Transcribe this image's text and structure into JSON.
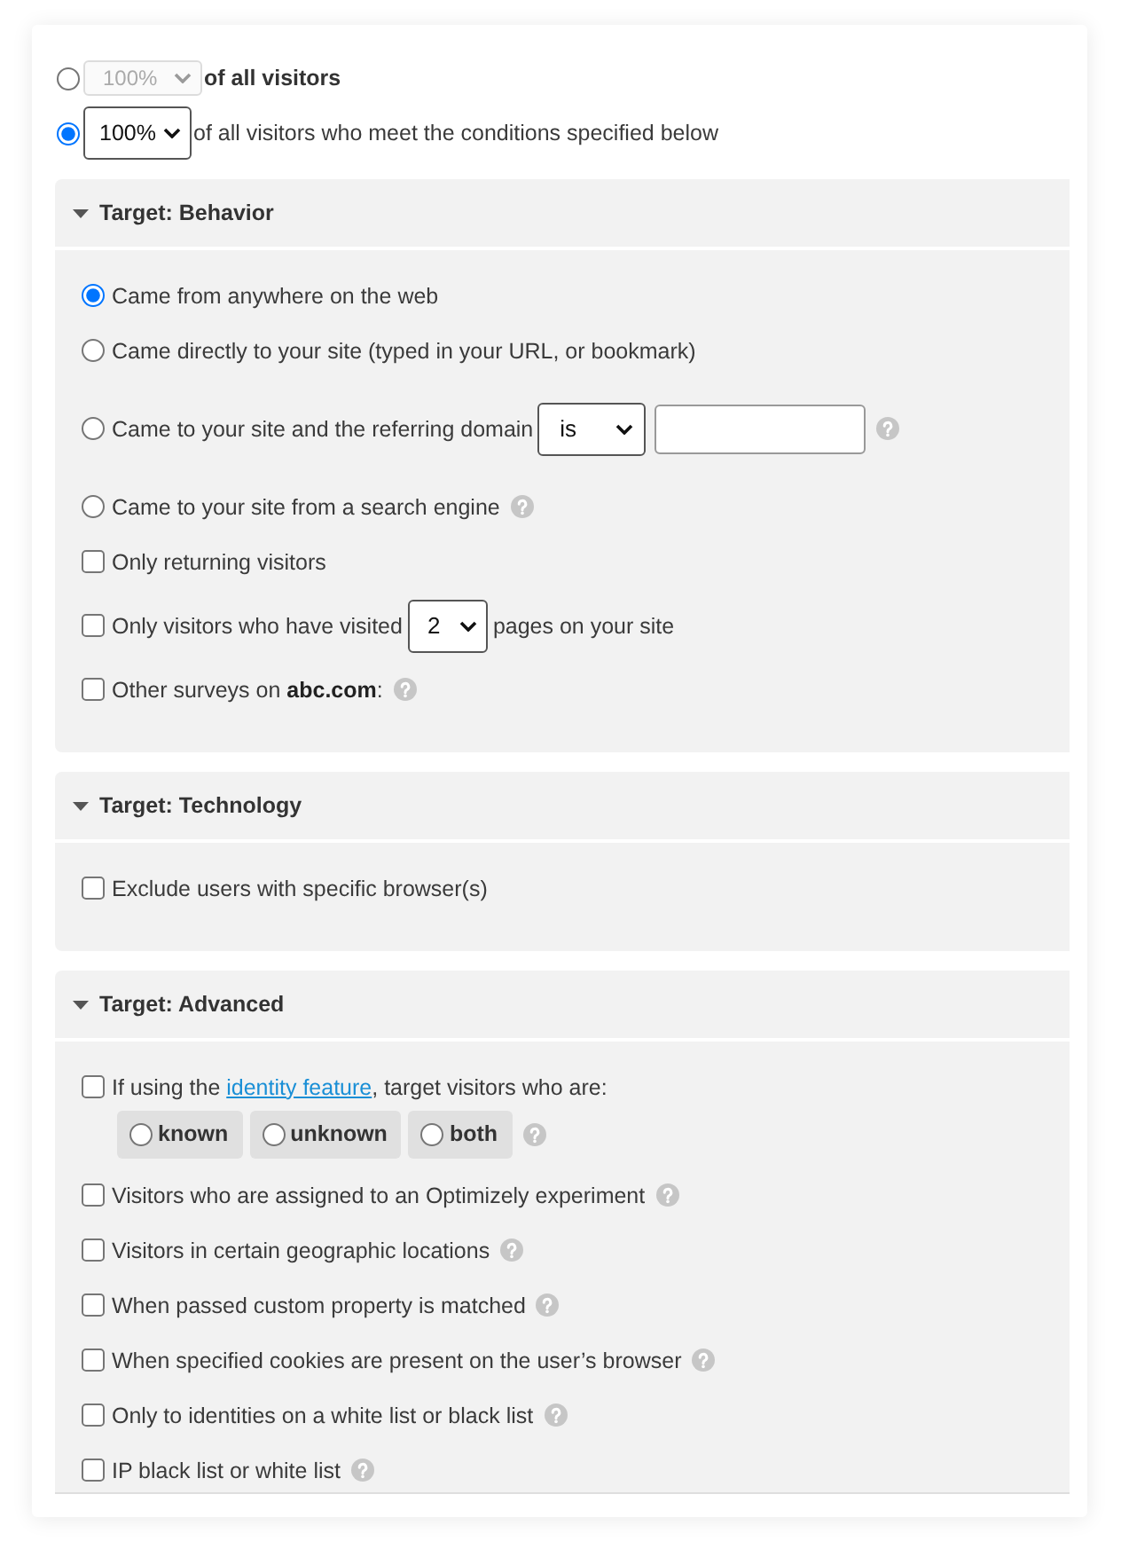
{
  "audience": {
    "options": [
      {
        "selected": false,
        "percent": {
          "value": "100%",
          "disabled": true
        },
        "label": "of all visitors",
        "bold": true
      },
      {
        "selected": true,
        "percent": {
          "value": "100%",
          "disabled": false
        },
        "label": "of all visitors who meet the conditions specified below",
        "bold": false
      }
    ]
  },
  "sections": [
    {
      "title": "Target: Behavior",
      "expanded": true,
      "items": [
        {
          "kind": "radio",
          "selected": true,
          "label": "Came from anywhere on the web",
          "help": false
        },
        {
          "kind": "radio",
          "selected": false,
          "label": "Came directly to your site (typed in your URL, or bookmark)",
          "help": false
        },
        {
          "kind": "radio",
          "selected": false,
          "label": "Came to your site and the referring domain",
          "select": "is",
          "text_field": true,
          "help": true
        },
        {
          "kind": "radio",
          "selected": false,
          "label": "Came to your site from a search engine",
          "help": true
        },
        {
          "kind": "checkbox",
          "checked": false,
          "label": "Only returning visitors",
          "help": false
        },
        {
          "kind": "checkbox",
          "checked": false,
          "label": "Only visitors who have visited",
          "select": "2",
          "label_after": "pages on your site",
          "help": false
        },
        {
          "kind": "checkbox",
          "checked": false,
          "label": "Other surveys on **abc.com**:",
          "help": true
        }
      ]
    },
    {
      "title": "Target: Technology",
      "expanded": true,
      "items": [
        {
          "kind": "checkbox",
          "checked": false,
          "label": "Exclude users with specific browser(s)",
          "help": false
        }
      ]
    },
    {
      "title": "Target: Advanced",
      "expanded": true,
      "items": [
        {
          "kind": "identity",
          "checked": false,
          "label_before": "If using the",
          "link": "identity feature",
          "label_after": ", target visitors who are:",
          "choices": [
            {
              "label": "known",
              "selected": false
            },
            {
              "label": "unknown",
              "selected": false
            },
            {
              "label": "both",
              "selected": false
            }
          ],
          "help": true
        },
        {
          "kind": "checkbox",
          "checked": false,
          "label": "Visitors who are assigned to an Optimizely experiment",
          "help": true
        },
        {
          "kind": "checkbox",
          "checked": false,
          "label": "Visitors in certain geographic locations",
          "help": true
        },
        {
          "kind": "checkbox",
          "checked": false,
          "label": "When passed custom property is matched",
          "help": true
        },
        {
          "kind": "checkbox",
          "checked": false,
          "label": "When specified cookies are present on the user’s browser",
          "help": true
        },
        {
          "kind": "checkbox",
          "checked": false,
          "label": "Only to identities on a white list or black list",
          "help": true
        },
        {
          "kind": "checkbox",
          "checked": false,
          "label": "IP black list or white list",
          "help": true
        }
      ]
    }
  ]
}
